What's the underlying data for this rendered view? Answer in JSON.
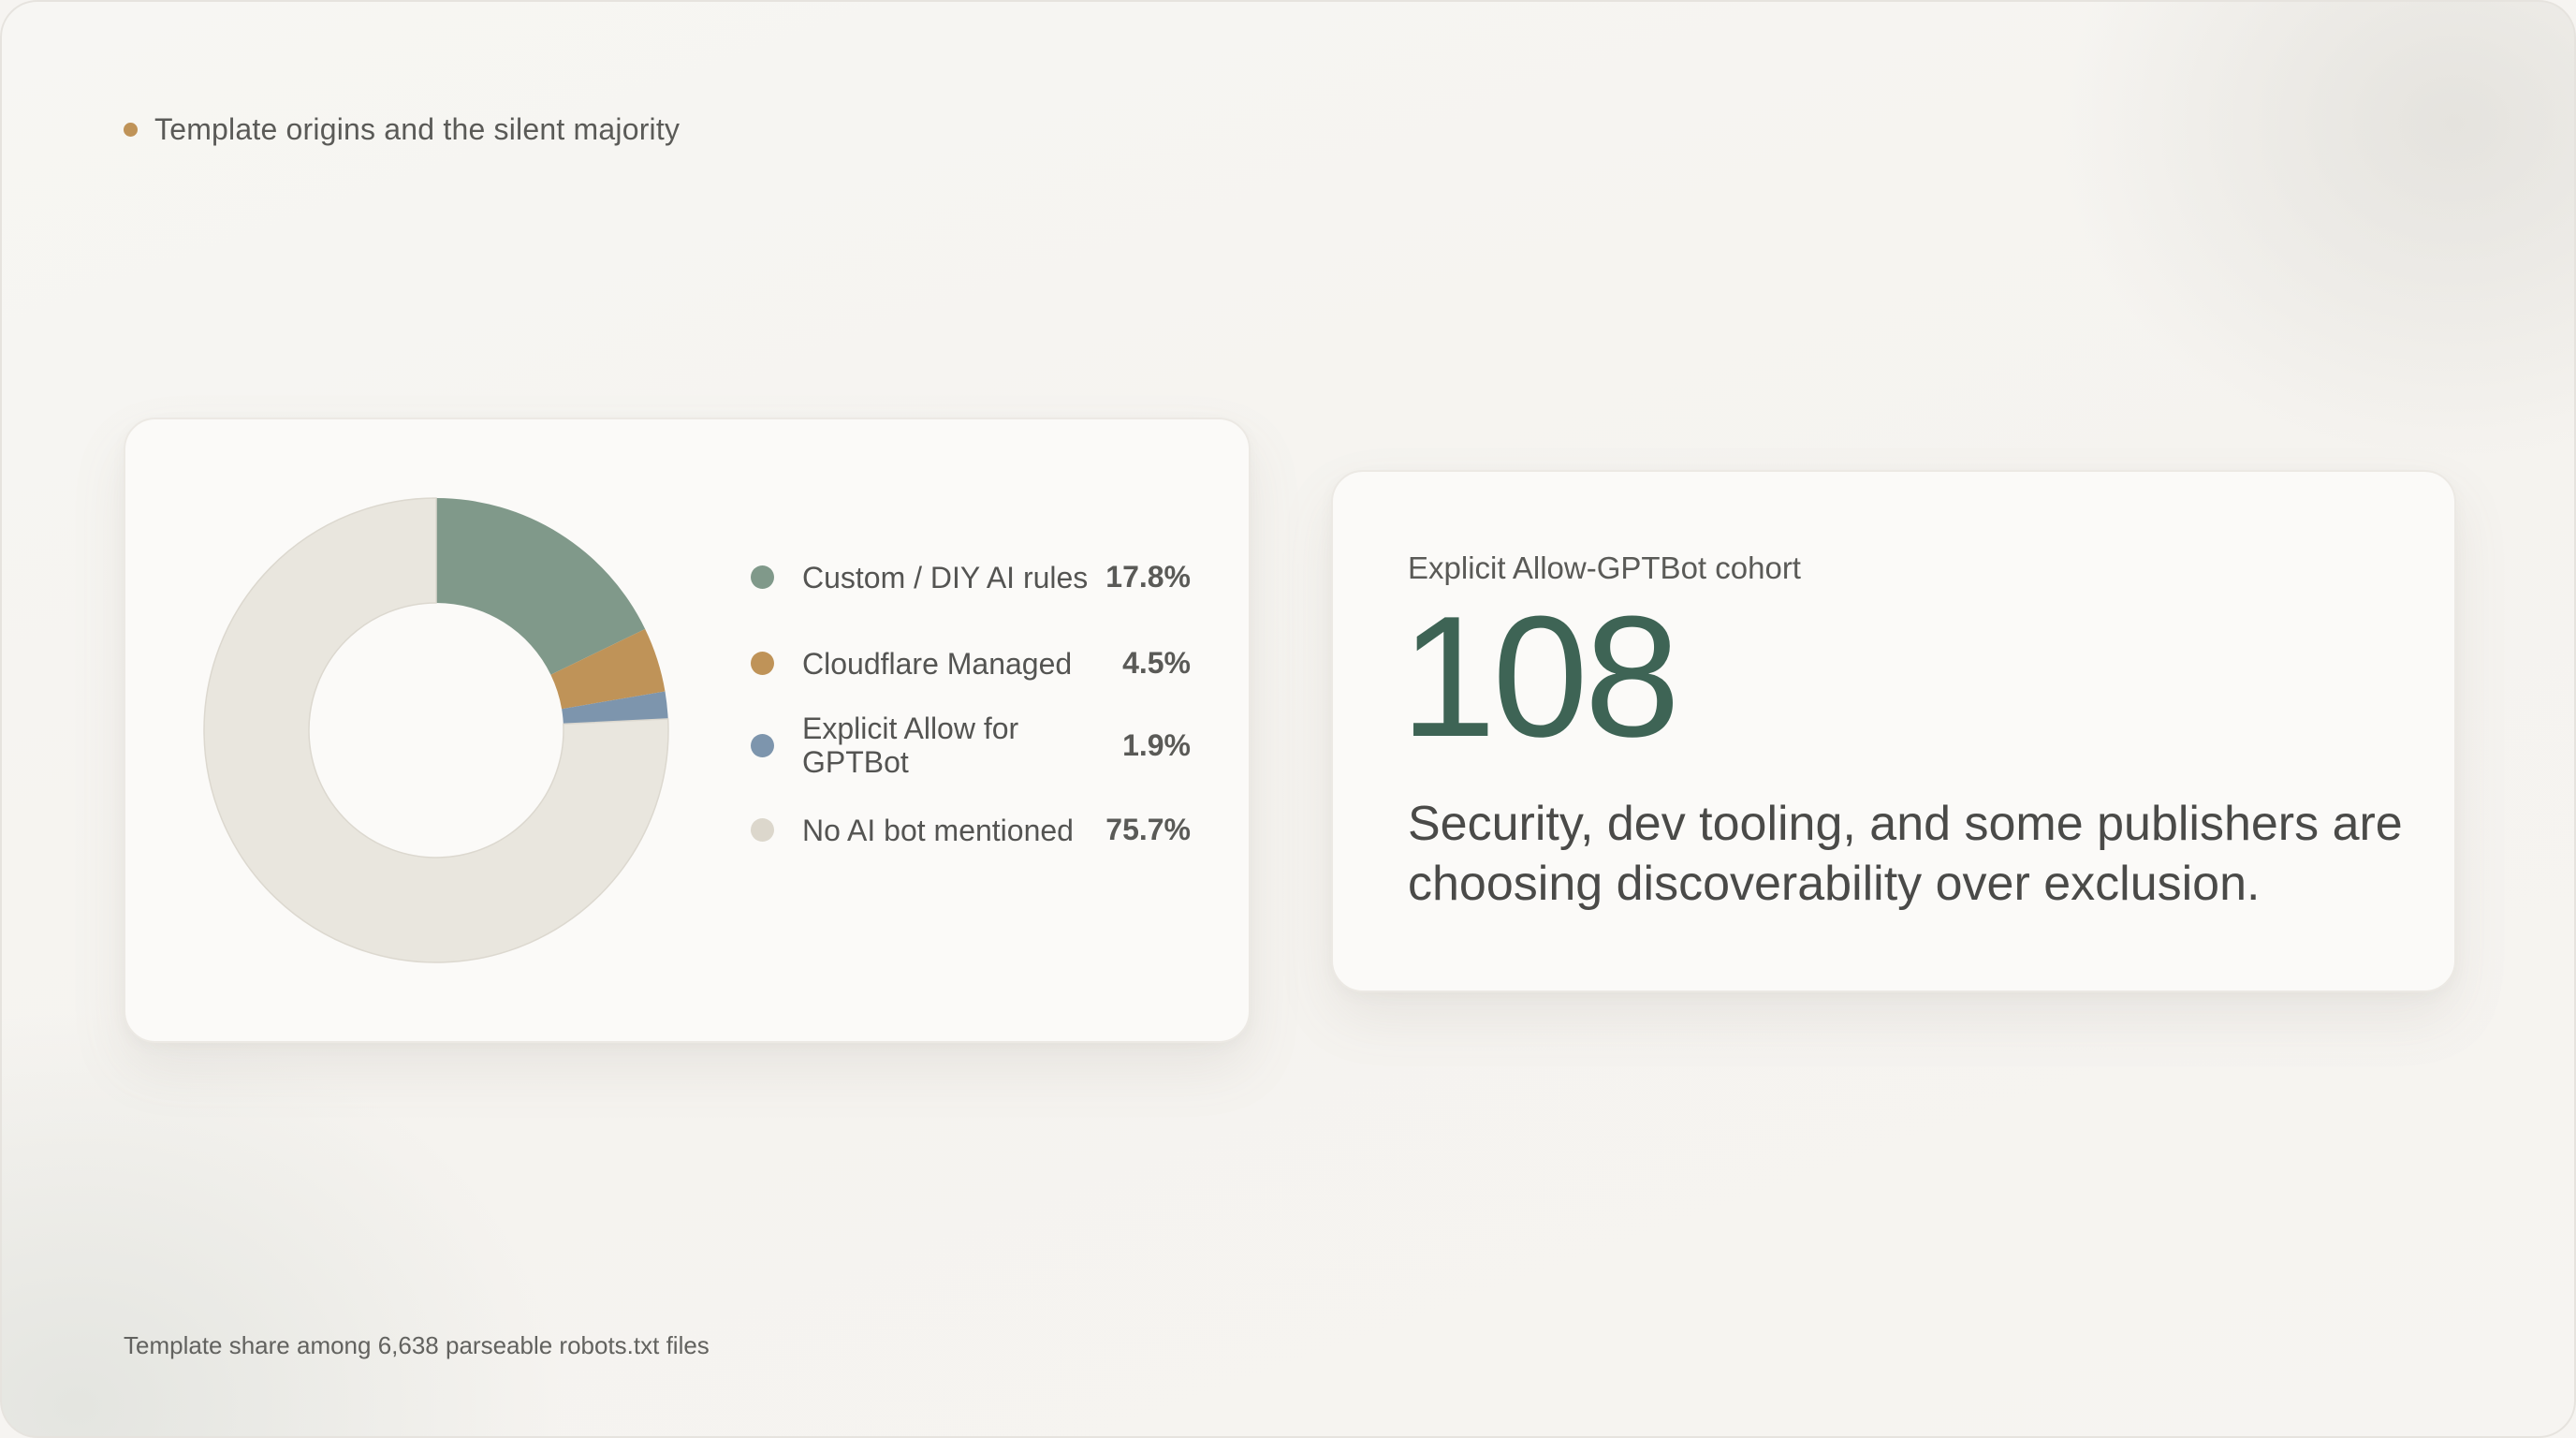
{
  "eyebrow": {
    "text": "Template origins and the silent majority",
    "dot_color": "#bf9358"
  },
  "chart_data": {
    "type": "pie",
    "variant": "donut",
    "categories": [
      "Custom / DIY AI rules",
      "Cloudflare Managed",
      "Explicit Allow for GPTBot",
      "No AI bot mentioned"
    ],
    "values": [
      17.8,
      4.5,
      1.9,
      75.7
    ],
    "value_labels": [
      "17.8%",
      "4.5%",
      "1.9%",
      "75.7%"
    ],
    "colors": [
      "#80998a",
      "#bf9358",
      "#7d95ad",
      "#e9e6de"
    ],
    "title": "",
    "legend_position": "right"
  },
  "stat": {
    "label": "Explicit Allow-GPTBot cohort",
    "value": "108",
    "description": "Security, dev tooling, and some publishers are choosing discoverability over exclusion.",
    "accent_color": "#3e6455"
  },
  "footnote": "Template share among 6,638 parseable robots.txt files"
}
